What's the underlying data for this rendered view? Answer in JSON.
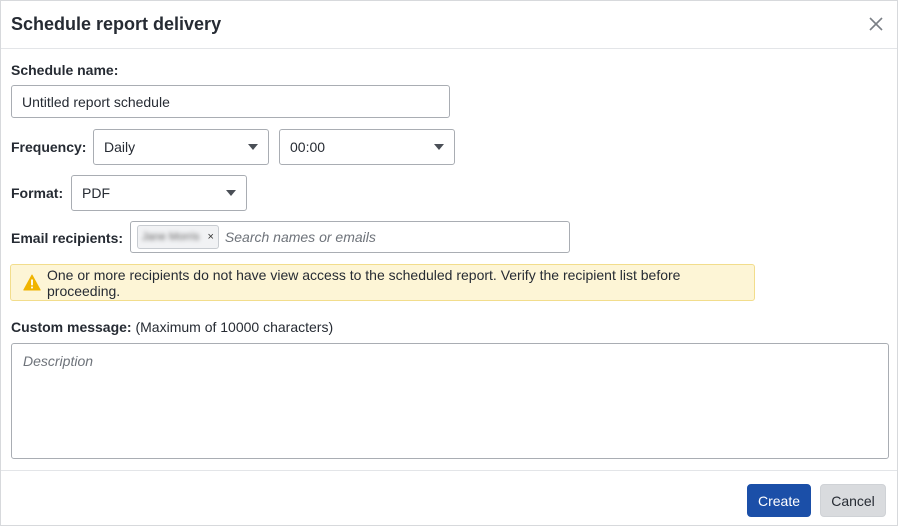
{
  "dialog": {
    "title": "Schedule report delivery",
    "close_icon": "close-icon"
  },
  "schedule_name": {
    "label": "Schedule name:",
    "value": "Untitled report schedule"
  },
  "frequency": {
    "label": "Frequency:",
    "period": "Daily",
    "time": "00:00"
  },
  "format": {
    "label": "Format:",
    "value": "PDF"
  },
  "recipients": {
    "label": "Email recipients:",
    "chip_name": "Jane Morris",
    "chip_remove": "×",
    "placeholder": "Search names or emails"
  },
  "warning": {
    "icon": "warning-icon",
    "text": "One or more recipients do not have view access to the scheduled report. Verify the recipient list before proceeding."
  },
  "custom_message": {
    "label": "Custom message:",
    "hint": "(Maximum of 10000 characters)",
    "placeholder": "Description"
  },
  "footer": {
    "create_label": "Create",
    "cancel_label": "Cancel"
  },
  "colors": {
    "primary": "#1b4fa8",
    "warning_bg": "#fdf5d6",
    "warning_icon": "#f0b400"
  }
}
